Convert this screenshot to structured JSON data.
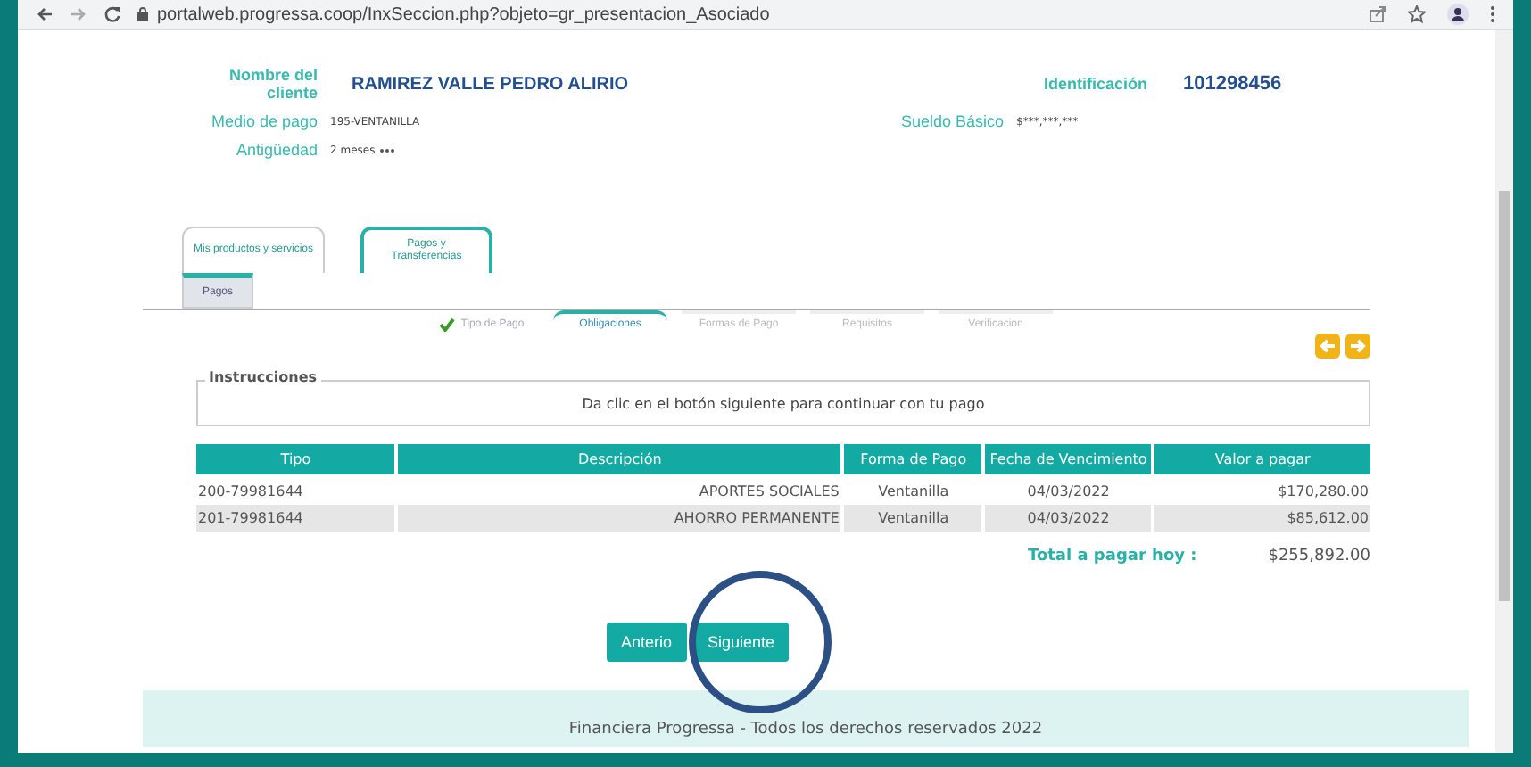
{
  "browser": {
    "url": "portalweb.progressa.coop/InxSeccion.php?objeto=gr_presentacion_Asociado"
  },
  "client": {
    "name_label": "Nombre del cliente",
    "name": "RAMIREZ VALLE PEDRO ALIRIO",
    "id_label": "Identificación",
    "id": "101298456",
    "payment_label": "Medio de pago",
    "payment": "195-VENTANILLA",
    "salary_label": "Sueldo Básico",
    "salary": "$***,***,***",
    "age_label": "Antigüedad",
    "age": "2 meses"
  },
  "tabs": [
    {
      "label": "Mis productos y servicios",
      "selected": false
    },
    {
      "label": "Pagos y Transferencias",
      "selected": true
    }
  ],
  "subtabs": [
    {
      "label": "Pagos",
      "selected": true
    }
  ],
  "steps": [
    {
      "label": "Tipo de Pago",
      "done": true,
      "selected": false
    },
    {
      "label": "Obligaciones",
      "done": false,
      "selected": true
    },
    {
      "label": "Formas de Pago",
      "done": false,
      "selected": false
    },
    {
      "label": "Requisitos",
      "done": false,
      "selected": false
    },
    {
      "label": "Verificacion",
      "done": false,
      "selected": false
    }
  ],
  "instructions": {
    "legend": "Instrucciones",
    "text": "Da clic en el botón siguiente para continuar con tu pago"
  },
  "table": {
    "columns": [
      "Tipo",
      "Descripción",
      "Forma de Pago",
      "Fecha de Vencimiento",
      "Valor a pagar"
    ],
    "rows": [
      [
        "200-79981644",
        "APORTES SOCIALES",
        "Ventanilla",
        "04/03/2022",
        "$170,280.00"
      ],
      [
        "201-79981644",
        "AHORRO PERMANENTE",
        "Ventanilla",
        "04/03/2022",
        "$85,612.00"
      ]
    ]
  },
  "total": {
    "label": "Total a pagar hoy :",
    "value": "$255,892.00"
  },
  "buttons": [
    "Anterio",
    "Siguiente"
  ],
  "footer": "Financiera Progressa - Todos los derechos reservados 2022"
}
